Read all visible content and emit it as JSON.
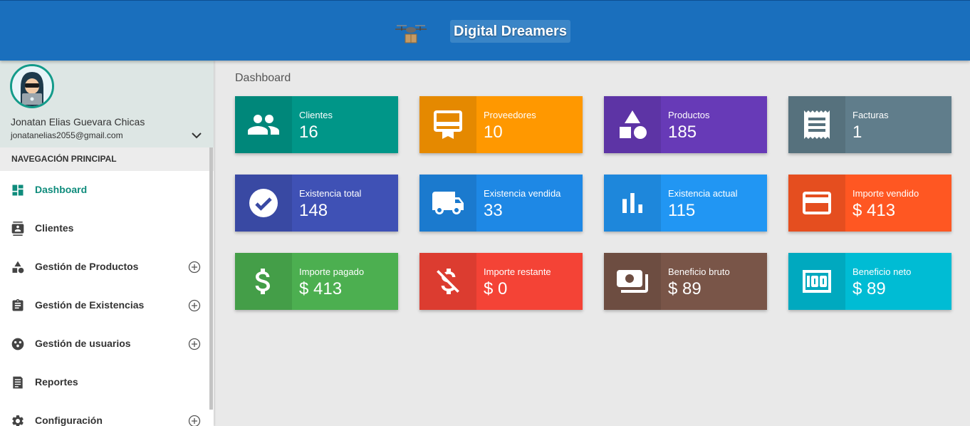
{
  "header": {
    "brand_name": "Digital Dreamers",
    "logo_icon": "drone-delivery-icon",
    "bar_color": "#1a6fbd"
  },
  "sidebar": {
    "user": {
      "name": "Jonatan Elias Guevara Chicas",
      "email": "jonatanelias2055@gmail.com",
      "avatar_icon": "hacker-avatar-icon"
    },
    "nav_header": "NAVEGACIÓN PRINCIPAL",
    "items": [
      {
        "label": "Dashboard",
        "icon": "dashboard-icon",
        "active": true,
        "expandable": false
      },
      {
        "label": "Clientes",
        "icon": "contacts-icon",
        "expandable": false
      },
      {
        "label": "Gestión de Productos",
        "icon": "category-icon",
        "expandable": true
      },
      {
        "label": "Gestión de Existencias",
        "icon": "assignment-icon",
        "expandable": true
      },
      {
        "label": "Gestión de usuarios",
        "icon": "users-group-icon",
        "expandable": true
      },
      {
        "label": "Reportes",
        "icon": "receipt-icon",
        "expandable": false
      },
      {
        "label": "Configuración",
        "icon": "gear-icon",
        "expandable": true
      }
    ],
    "accent_color": "#0f8c7c"
  },
  "main": {
    "title": "Dashboard",
    "cards": [
      {
        "label": "Clientes",
        "value": "16",
        "icon": "people-icon",
        "color": "#009688",
        "dark": "#00877a"
      },
      {
        "label": "Proveedores",
        "value": "10",
        "icon": "card-membership-icon",
        "color": "#ff9800",
        "dark": "#e58900"
      },
      {
        "label": "Productos",
        "value": "185",
        "icon": "category-shapes-icon",
        "color": "#673ab7",
        "dark": "#5d34a5"
      },
      {
        "label": "Facturas",
        "value": "1",
        "icon": "receipt-icon",
        "color": "#607d8b",
        "dark": "#56717d"
      },
      {
        "label": "Existencia total",
        "value": "148",
        "icon": "check-circle-icon",
        "color": "#3f51b5",
        "dark": "#3949a3"
      },
      {
        "label": "Existencia vendida",
        "value": "33",
        "icon": "truck-icon",
        "color": "#1e88e5",
        "dark": "#1b7ace"
      },
      {
        "label": "Existencia actual",
        "value": "115",
        "icon": "bar-chart-icon",
        "color": "#2196f3",
        "dark": "#1e87db"
      },
      {
        "label": "Importe vendido",
        "value": "$ 413",
        "icon": "credit-card-icon",
        "color": "#ff5722",
        "dark": "#e54e1f"
      },
      {
        "label": "Importe pagado",
        "value": "$ 413",
        "icon": "dollar-icon",
        "color": "#4caf50",
        "dark": "#449e48"
      },
      {
        "label": "Importe restante",
        "value": "$ 0",
        "icon": "money-off-icon",
        "color": "#f44336",
        "dark": "#dc3c30"
      },
      {
        "label": "Beneficio bruto",
        "value": "$ 89",
        "icon": "money-stack-icon",
        "color": "#795548",
        "dark": "#6d4d41"
      },
      {
        "label": "Beneficio neto",
        "value": "$ 89",
        "icon": "cash-100-icon",
        "color": "#00bcd4",
        "dark": "#00a9bf"
      }
    ]
  }
}
